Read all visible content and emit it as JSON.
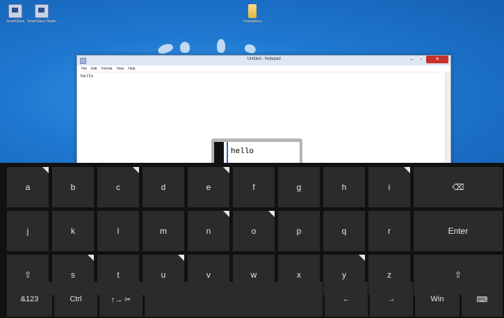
{
  "desktop": {
    "icons": [
      {
        "label": "SmartGlass"
      },
      {
        "label": "SmartGlass Studio"
      },
      {
        "label": "Translations"
      }
    ]
  },
  "notepad": {
    "title": "Untitled - Notepad",
    "controls": {
      "minimize": "–",
      "maximize": "▫",
      "close": "✕"
    },
    "menu": [
      "File",
      "Edit",
      "Format",
      "View",
      "Help"
    ],
    "content": "hello"
  },
  "candidate": {
    "text": "hello"
  },
  "keyboard": {
    "rows": [
      [
        {
          "label": "a",
          "alt": true
        },
        {
          "label": "b",
          "alt": false
        },
        {
          "label": "c",
          "alt": true
        },
        {
          "label": "d",
          "alt": false
        },
        {
          "label": "e",
          "alt": true
        },
        {
          "label": "f",
          "alt": false
        },
        {
          "label": "g",
          "alt": false
        },
        {
          "label": "h",
          "alt": false
        },
        {
          "label": "i",
          "alt": true
        },
        {
          "label": "⌫",
          "alt": false,
          "name": "backspace-key"
        }
      ],
      [
        {
          "label": "j",
          "alt": false
        },
        {
          "label": "k",
          "alt": false
        },
        {
          "label": "l",
          "alt": false
        },
        {
          "label": "m",
          "alt": false
        },
        {
          "label": "n",
          "alt": true
        },
        {
          "label": "o",
          "alt": true
        },
        {
          "label": "p",
          "alt": false
        },
        {
          "label": "q",
          "alt": false
        },
        {
          "label": "r",
          "alt": false
        },
        {
          "label": "Enter",
          "alt": false,
          "name": "enter-key"
        }
      ],
      [
        {
          "label": "⇧",
          "alt": false,
          "name": "shift-key"
        },
        {
          "label": "s",
          "alt": true
        },
        {
          "label": "t",
          "alt": false
        },
        {
          "label": "u",
          "alt": true
        },
        {
          "label": "v",
          "alt": false
        },
        {
          "label": "w",
          "alt": false
        },
        {
          "label": "x",
          "alt": false
        },
        {
          "label": "y",
          "alt": true
        },
        {
          "label": "z",
          "alt": false
        },
        {
          "label": "⇧",
          "alt": false,
          "name": "shift-right-key"
        }
      ],
      [
        {
          "label": "&123",
          "name": "symbols-key"
        },
        {
          "label": "Ctrl",
          "name": "ctrl-key"
        },
        {
          "label": "↑→ ✂",
          "name": "edit-keys-key"
        },
        {
          "label": "",
          "name": "space-key"
        },
        {
          "label": "←",
          "name": "left-arrow-key"
        },
        {
          "label": "→",
          "name": "right-arrow-key"
        },
        {
          "label": "Win",
          "name": "win-key"
        },
        {
          "label": "⌨",
          "name": "keyboard-switch-key"
        }
      ]
    ]
  }
}
